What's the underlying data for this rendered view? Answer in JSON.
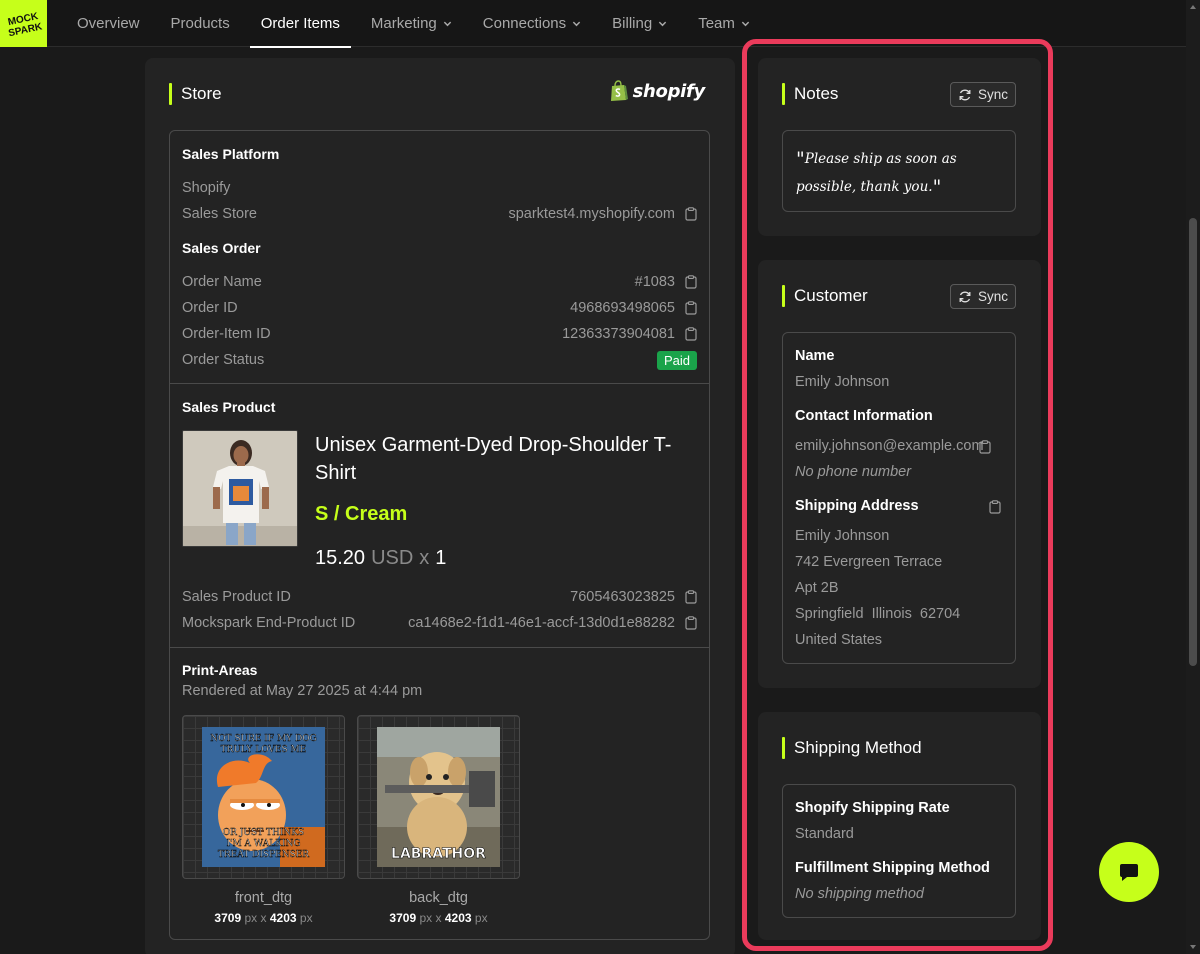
{
  "brand": {
    "logo_text": "MOCK SPARK",
    "accent": "#c6ff1a",
    "highlight": "#ea3b5b",
    "paid_color": "#1aa34a"
  },
  "nav": [
    {
      "label": "Overview",
      "dropdown": false,
      "active": false
    },
    {
      "label": "Products",
      "dropdown": false,
      "active": false
    },
    {
      "label": "Order Items",
      "dropdown": false,
      "active": true
    },
    {
      "label": "Marketing",
      "dropdown": true,
      "active": false
    },
    {
      "label": "Connections",
      "dropdown": true,
      "active": false
    },
    {
      "label": "Billing",
      "dropdown": true,
      "active": false
    },
    {
      "label": "Team",
      "dropdown": true,
      "active": false
    }
  ],
  "store": {
    "title": "Store",
    "platform_logo": "shopify",
    "sales_platform": {
      "heading": "Sales Platform",
      "platform": "Shopify",
      "store_label": "Sales Store",
      "store_value": "sparktest4.myshopify.com"
    },
    "sales_order": {
      "heading": "Sales Order",
      "order_name_label": "Order Name",
      "order_name": "#1083",
      "order_id_label": "Order ID",
      "order_id": "4968693498065",
      "order_item_id_label": "Order-Item ID",
      "order_item_id": "12363373904081",
      "status_label": "Order Status",
      "status": "Paid"
    },
    "sales_product": {
      "heading": "Sales Product",
      "name": "Unisex Garment-Dyed Drop-Shoulder T-Shirt",
      "variant": "S / Cream",
      "price": "15.20",
      "currency": "USD",
      "times": "x",
      "quantity": "1",
      "product_id_label": "Sales Product ID",
      "product_id": "7605463023825",
      "end_product_label": "Mockspark End-Product ID",
      "end_product_id": "ca1468e2-f1d1-46e1-accf-13d0d1e88282"
    },
    "print_areas": {
      "heading": "Print-Areas",
      "rendered": "Rendered at May 27 2025 at 4:44 pm",
      "tiles": [
        {
          "name": "front_dtg",
          "w": "3709",
          "h": "4203",
          "unit": "px",
          "sep": "x",
          "art_top": "NOT SURE IF MY DOG TRULY LOVES ME",
          "art_bottom": "OR JUST THINKS I'M A WALKING TREAT DISPENSER"
        },
        {
          "name": "back_dtg",
          "w": "3709",
          "h": "4203",
          "unit": "px",
          "sep": "x",
          "art_caption": "LABRATHOR"
        }
      ]
    }
  },
  "notes": {
    "title": "Notes",
    "sync_label": "Sync",
    "text": "Please ship as soon as possible, thank you."
  },
  "customer": {
    "title": "Customer",
    "sync_label": "Sync",
    "name_label": "Name",
    "name": "Emily Johnson",
    "contact_label": "Contact Information",
    "email": "emily.johnson@example.com",
    "phone": "No phone number",
    "address_label": "Shipping Address",
    "address": [
      "Emily Johnson",
      "742 Evergreen Terrace",
      "Apt 2B",
      "Springfield  Illinois  62704",
      "United States"
    ]
  },
  "shipping": {
    "title": "Shipping Method",
    "rate_label": "Shopify Shipping Rate",
    "rate": "Standard",
    "method_label": "Fulfillment Shipping Method",
    "method": "No shipping method"
  }
}
